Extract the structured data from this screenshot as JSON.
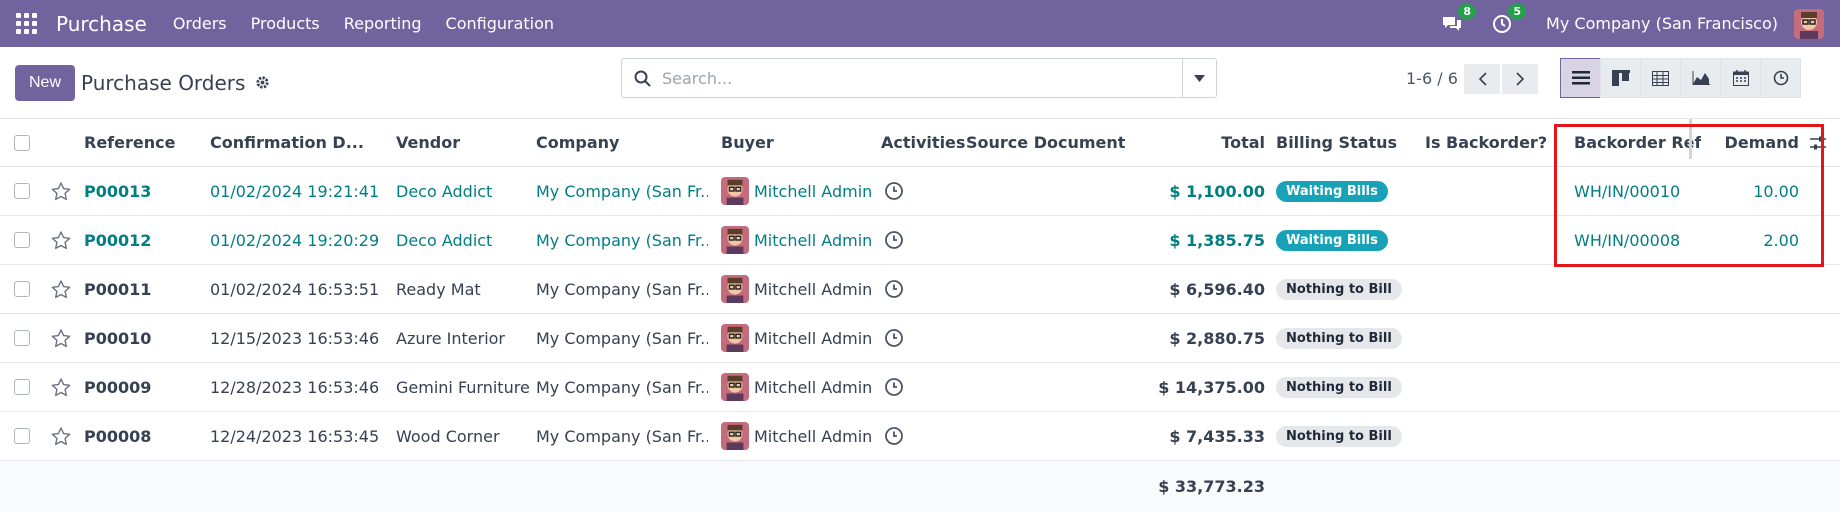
{
  "navbar": {
    "brand": "Purchase",
    "menus": [
      "Orders",
      "Products",
      "Reporting",
      "Configuration"
    ],
    "messages_count": "8",
    "activities_count": "5",
    "company": "My Company (San Francisco)"
  },
  "control": {
    "new_label": "New",
    "title": "Purchase Orders",
    "search_placeholder": "Search...",
    "pager": "1-6 / 6"
  },
  "columns": {
    "reference": "Reference",
    "confirmation_date": "Confirmation D...",
    "vendor": "Vendor",
    "company": "Company",
    "buyer": "Buyer",
    "activities": "Activities",
    "source_document": "Source Document",
    "total": "Total",
    "billing_status": "Billing Status",
    "is_backorder": "Is Backorder?",
    "backorder_ref": "Backorder Ref",
    "demand": "Demand"
  },
  "rows": [
    {
      "reference": "P00013",
      "date": "01/02/2024 19:21:41",
      "vendor": "Deco Addict",
      "company": "My Company (San Fr...",
      "buyer": "Mitchell Admin",
      "total": "$ 1,100.00",
      "billing": "Waiting Bills",
      "backorder_ref": "WH/IN/00010",
      "demand": "10.00"
    },
    {
      "reference": "P00012",
      "date": "01/02/2024 19:20:29",
      "vendor": "Deco Addict",
      "company": "My Company (San Fr...",
      "buyer": "Mitchell Admin",
      "total": "$ 1,385.75",
      "billing": "Waiting Bills",
      "backorder_ref": "WH/IN/00008",
      "demand": "2.00"
    },
    {
      "reference": "P00011",
      "date": "01/02/2024 16:53:51",
      "vendor": "Ready Mat",
      "company": "My Company (San Fr...",
      "buyer": "Mitchell Admin",
      "total": "$ 6,596.40",
      "billing": "Nothing to Bill",
      "backorder_ref": "",
      "demand": ""
    },
    {
      "reference": "P00010",
      "date": "12/15/2023 16:53:46",
      "vendor": "Azure Interior",
      "company": "My Company (San Fr...",
      "buyer": "Mitchell Admin",
      "total": "$ 2,880.75",
      "billing": "Nothing to Bill",
      "backorder_ref": "",
      "demand": ""
    },
    {
      "reference": "P00009",
      "date": "12/28/2023 16:53:46",
      "vendor": "Gemini Furniture",
      "company": "My Company (San Fr...",
      "buyer": "Mitchell Admin",
      "total": "$ 14,375.00",
      "billing": "Nothing to Bill",
      "backorder_ref": "",
      "demand": ""
    },
    {
      "reference": "P00008",
      "date": "12/24/2023 16:53:45",
      "vendor": "Wood Corner",
      "company": "My Company (San Fr...",
      "buyer": "Mitchell Admin",
      "total": "$ 7,435.33",
      "billing": "Nothing to Bill",
      "backorder_ref": "",
      "demand": ""
    }
  ],
  "grand_total": "$ 33,773.23",
  "colors": {
    "brand": "#71639e",
    "link": "#017e84",
    "waiting": "#17a2b8",
    "highlight": "#e3161c"
  }
}
